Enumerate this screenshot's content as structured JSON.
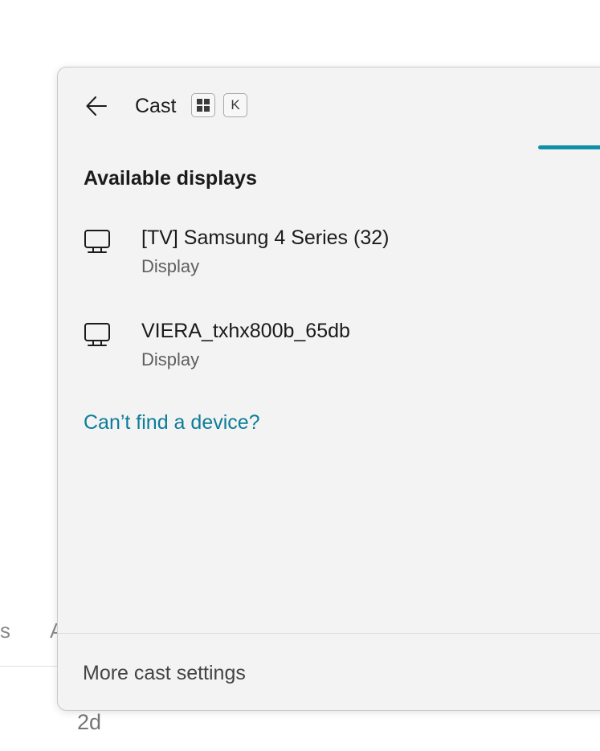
{
  "background": {
    "fragment_left": "s",
    "fragment_second": "A",
    "timestamp": "2d"
  },
  "panel": {
    "title": "Cast",
    "shortcut_key": "K",
    "back_icon": "arrow-left-icon",
    "win_key_icon": "windows-logo-icon",
    "accent_color": "#0f8fa8",
    "section_title": "Available displays",
    "devices": [
      {
        "name": "[TV] Samsung 4 Series (32)",
        "type": "Display",
        "icon": "monitor-icon"
      },
      {
        "name": "VIERA_txhx800b_65db",
        "type": "Display",
        "icon": "monitor-icon"
      }
    ],
    "help_link": "Can’t find a device?",
    "link_color": "#0d7d99",
    "footer_link": "More cast settings"
  }
}
